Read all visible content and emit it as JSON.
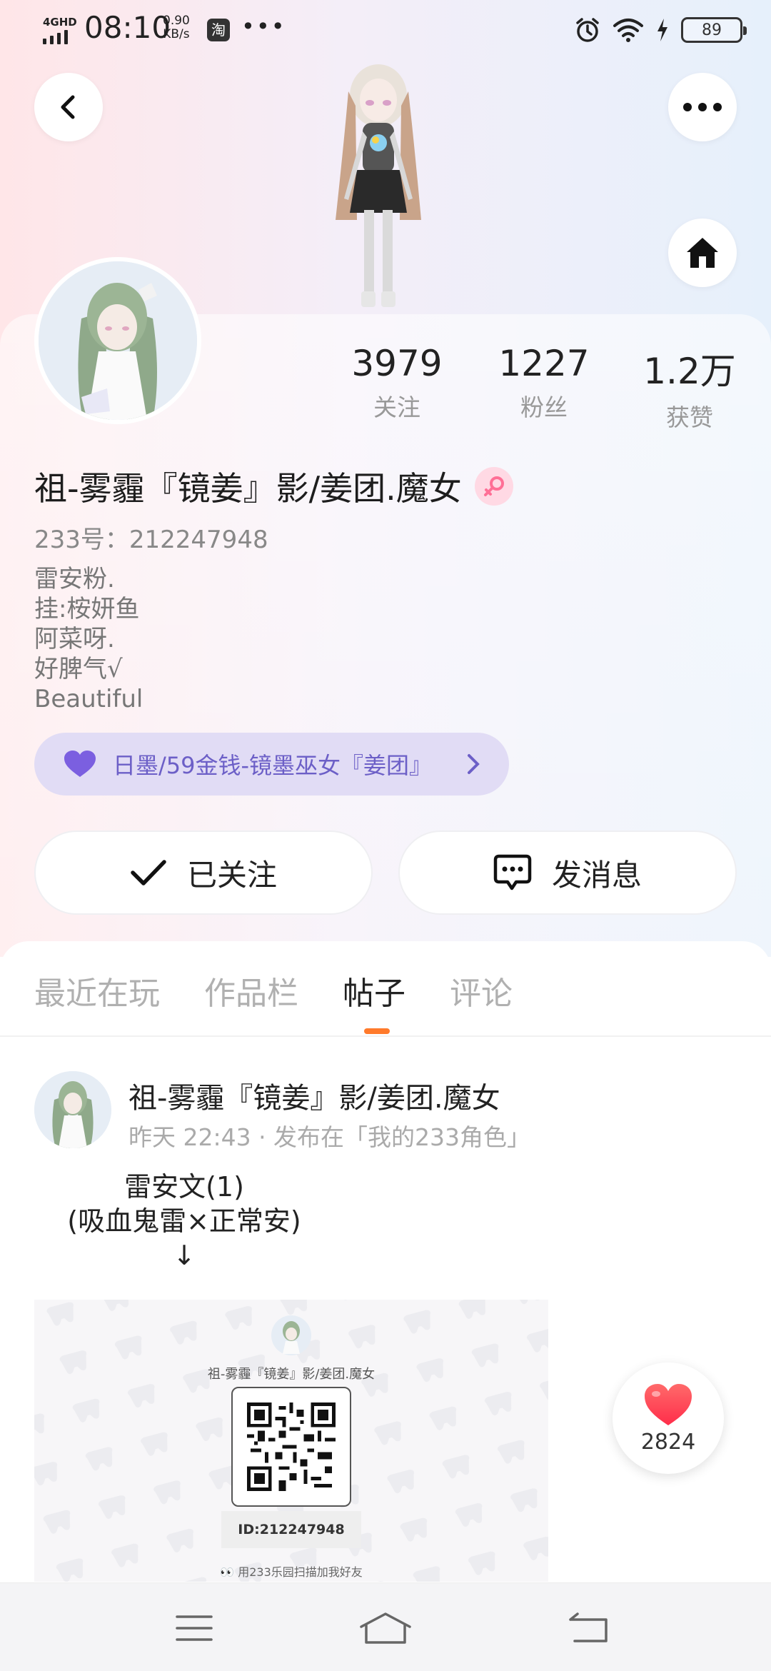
{
  "status_bar": {
    "network": "4GHD",
    "time": "08:10",
    "speed_value": "0.90",
    "speed_unit": "KB/s",
    "app_icon": "淘",
    "more": "•••",
    "battery": "89"
  },
  "profile": {
    "stats": [
      {
        "value": "3979",
        "label": "关注"
      },
      {
        "value": "1227",
        "label": "粉丝"
      },
      {
        "value": "1.2万",
        "label": "获赞"
      }
    ],
    "username": "祖-雾霾『镜姜』影/姜团.魔女",
    "gender": "female",
    "id_line": "233号：212247948",
    "bio": [
      "雷安粉.",
      "挂:桉妍鱼",
      "阿菜呀.",
      "好脾气√",
      "Beautiful"
    ],
    "guild_label": "日墨/59金钱-镜墨巫女『姜团』",
    "follow_label": "已关注",
    "message_label": "发消息"
  },
  "tabs": [
    "最近在玩",
    "作品栏",
    "帖子",
    "评论"
  ],
  "active_tab": "帖子",
  "post": {
    "author": "祖-雾霾『镜姜』影/姜团.魔女",
    "meta": "昨天 22:43 · 发布在「我的233角色」",
    "text_lines": [
      "雷安文(1)",
      "(吸血鬼雷×正常安)",
      "↓"
    ],
    "image": {
      "name": "祖-雾霾『镜姜』影/姜团.魔女",
      "id": "ID:212247948",
      "hint": "👀 用233乐园扫描加我好友"
    }
  },
  "like_count": "2824",
  "colors": {
    "accent": "#ff7a2b",
    "guild_text": "#6c5fc7",
    "guild_bg": "#e1dcf5",
    "heart": "#ff4b5c"
  }
}
